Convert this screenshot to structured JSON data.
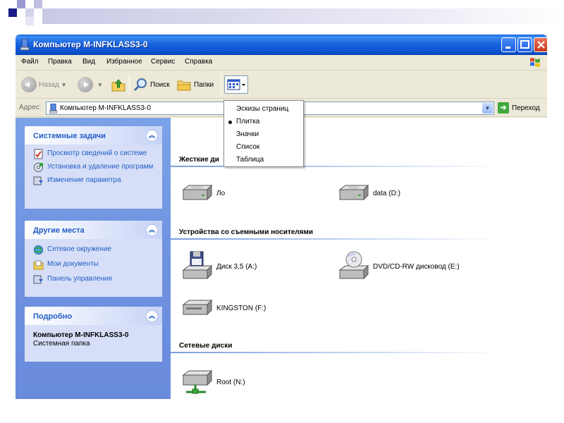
{
  "window": {
    "title": "Компьютер M-INFKLASS3-0"
  },
  "menu": [
    "Файл",
    "Правка",
    "Вид",
    "Избранное",
    "Сервис",
    "Справка"
  ],
  "toolbar": {
    "back": "Назад",
    "search": "Поиск",
    "folders": "Папки"
  },
  "address": {
    "label": "Адрес:",
    "value": "Компьютер M-INFKLASS3-0",
    "go": "Переход"
  },
  "views_menu": {
    "items": [
      "Эскизы страниц",
      "Плитка",
      "Значки",
      "Список",
      "Таблица"
    ],
    "selected": "Плитка"
  },
  "left": {
    "system_tasks": {
      "title": "Системные задачи",
      "items": [
        "Просмотр сведений о системе",
        "Установка и удаление программ",
        "Изменение параметра"
      ]
    },
    "other_places": {
      "title": "Другие места",
      "items": [
        "Сетевое окружение",
        "Мои документы",
        "Панель управления"
      ]
    },
    "details": {
      "title": "Подробно",
      "name": "Компьютер M-INFKLASS3-0",
      "type": "Системная папка"
    }
  },
  "sections": {
    "hard_disks": {
      "title": "Жесткие ди",
      "drives": [
        "Ло",
        "data (D:)"
      ]
    },
    "removable": {
      "title": "Устройства со съемными носителями",
      "drives": [
        "Диск 3,5 (A:)",
        "DVD/CD-RW дисковод (E:)",
        "KINGSTON (F:)"
      ]
    },
    "network": {
      "title": "Сетевые диски",
      "drives": [
        "Root (N:)"
      ]
    }
  },
  "colors": {
    "title_bar": "#0a52cf",
    "task_link": "#215dc6",
    "pane_bg": "#6f92e0"
  }
}
